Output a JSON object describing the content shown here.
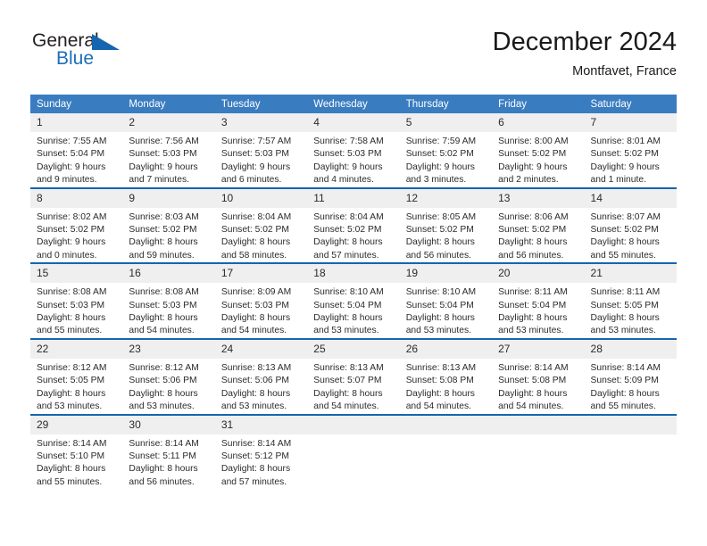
{
  "logo": {
    "word_top": "General",
    "word_bottom": "Blue",
    "triangle_color": "#1565b0",
    "blue_text_color": "#1c6fba"
  },
  "header": {
    "month_title": "December 2024",
    "location": "Montfavet, France"
  },
  "theme": {
    "header_blue": "#3a7cc0",
    "row_border_blue": "#1565b0",
    "daynum_bg": "#efefef"
  },
  "calendar": {
    "weekday_headers": [
      "Sunday",
      "Monday",
      "Tuesday",
      "Wednesday",
      "Thursday",
      "Friday",
      "Saturday"
    ],
    "weeks": [
      [
        {
          "day": "1",
          "sunrise": "Sunrise: 7:55 AM",
          "sunset": "Sunset: 5:04 PM",
          "daylight1": "Daylight: 9 hours",
          "daylight2": "and 9 minutes."
        },
        {
          "day": "2",
          "sunrise": "Sunrise: 7:56 AM",
          "sunset": "Sunset: 5:03 PM",
          "daylight1": "Daylight: 9 hours",
          "daylight2": "and 7 minutes."
        },
        {
          "day": "3",
          "sunrise": "Sunrise: 7:57 AM",
          "sunset": "Sunset: 5:03 PM",
          "daylight1": "Daylight: 9 hours",
          "daylight2": "and 6 minutes."
        },
        {
          "day": "4",
          "sunrise": "Sunrise: 7:58 AM",
          "sunset": "Sunset: 5:03 PM",
          "daylight1": "Daylight: 9 hours",
          "daylight2": "and 4 minutes."
        },
        {
          "day": "5",
          "sunrise": "Sunrise: 7:59 AM",
          "sunset": "Sunset: 5:02 PM",
          "daylight1": "Daylight: 9 hours",
          "daylight2": "and 3 minutes."
        },
        {
          "day": "6",
          "sunrise": "Sunrise: 8:00 AM",
          "sunset": "Sunset: 5:02 PM",
          "daylight1": "Daylight: 9 hours",
          "daylight2": "and 2 minutes."
        },
        {
          "day": "7",
          "sunrise": "Sunrise: 8:01 AM",
          "sunset": "Sunset: 5:02 PM",
          "daylight1": "Daylight: 9 hours",
          "daylight2": "and 1 minute."
        }
      ],
      [
        {
          "day": "8",
          "sunrise": "Sunrise: 8:02 AM",
          "sunset": "Sunset: 5:02 PM",
          "daylight1": "Daylight: 9 hours",
          "daylight2": "and 0 minutes."
        },
        {
          "day": "9",
          "sunrise": "Sunrise: 8:03 AM",
          "sunset": "Sunset: 5:02 PM",
          "daylight1": "Daylight: 8 hours",
          "daylight2": "and 59 minutes."
        },
        {
          "day": "10",
          "sunrise": "Sunrise: 8:04 AM",
          "sunset": "Sunset: 5:02 PM",
          "daylight1": "Daylight: 8 hours",
          "daylight2": "and 58 minutes."
        },
        {
          "day": "11",
          "sunrise": "Sunrise: 8:04 AM",
          "sunset": "Sunset: 5:02 PM",
          "daylight1": "Daylight: 8 hours",
          "daylight2": "and 57 minutes."
        },
        {
          "day": "12",
          "sunrise": "Sunrise: 8:05 AM",
          "sunset": "Sunset: 5:02 PM",
          "daylight1": "Daylight: 8 hours",
          "daylight2": "and 56 minutes."
        },
        {
          "day": "13",
          "sunrise": "Sunrise: 8:06 AM",
          "sunset": "Sunset: 5:02 PM",
          "daylight1": "Daylight: 8 hours",
          "daylight2": "and 56 minutes."
        },
        {
          "day": "14",
          "sunrise": "Sunrise: 8:07 AM",
          "sunset": "Sunset: 5:02 PM",
          "daylight1": "Daylight: 8 hours",
          "daylight2": "and 55 minutes."
        }
      ],
      [
        {
          "day": "15",
          "sunrise": "Sunrise: 8:08 AM",
          "sunset": "Sunset: 5:03 PM",
          "daylight1": "Daylight: 8 hours",
          "daylight2": "and 55 minutes."
        },
        {
          "day": "16",
          "sunrise": "Sunrise: 8:08 AM",
          "sunset": "Sunset: 5:03 PM",
          "daylight1": "Daylight: 8 hours",
          "daylight2": "and 54 minutes."
        },
        {
          "day": "17",
          "sunrise": "Sunrise: 8:09 AM",
          "sunset": "Sunset: 5:03 PM",
          "daylight1": "Daylight: 8 hours",
          "daylight2": "and 54 minutes."
        },
        {
          "day": "18",
          "sunrise": "Sunrise: 8:10 AM",
          "sunset": "Sunset: 5:04 PM",
          "daylight1": "Daylight: 8 hours",
          "daylight2": "and 53 minutes."
        },
        {
          "day": "19",
          "sunrise": "Sunrise: 8:10 AM",
          "sunset": "Sunset: 5:04 PM",
          "daylight1": "Daylight: 8 hours",
          "daylight2": "and 53 minutes."
        },
        {
          "day": "20",
          "sunrise": "Sunrise: 8:11 AM",
          "sunset": "Sunset: 5:04 PM",
          "daylight1": "Daylight: 8 hours",
          "daylight2": "and 53 minutes."
        },
        {
          "day": "21",
          "sunrise": "Sunrise: 8:11 AM",
          "sunset": "Sunset: 5:05 PM",
          "daylight1": "Daylight: 8 hours",
          "daylight2": "and 53 minutes."
        }
      ],
      [
        {
          "day": "22",
          "sunrise": "Sunrise: 8:12 AM",
          "sunset": "Sunset: 5:05 PM",
          "daylight1": "Daylight: 8 hours",
          "daylight2": "and 53 minutes."
        },
        {
          "day": "23",
          "sunrise": "Sunrise: 8:12 AM",
          "sunset": "Sunset: 5:06 PM",
          "daylight1": "Daylight: 8 hours",
          "daylight2": "and 53 minutes."
        },
        {
          "day": "24",
          "sunrise": "Sunrise: 8:13 AM",
          "sunset": "Sunset: 5:06 PM",
          "daylight1": "Daylight: 8 hours",
          "daylight2": "and 53 minutes."
        },
        {
          "day": "25",
          "sunrise": "Sunrise: 8:13 AM",
          "sunset": "Sunset: 5:07 PM",
          "daylight1": "Daylight: 8 hours",
          "daylight2": "and 54 minutes."
        },
        {
          "day": "26",
          "sunrise": "Sunrise: 8:13 AM",
          "sunset": "Sunset: 5:08 PM",
          "daylight1": "Daylight: 8 hours",
          "daylight2": "and 54 minutes."
        },
        {
          "day": "27",
          "sunrise": "Sunrise: 8:14 AM",
          "sunset": "Sunset: 5:08 PM",
          "daylight1": "Daylight: 8 hours",
          "daylight2": "and 54 minutes."
        },
        {
          "day": "28",
          "sunrise": "Sunrise: 8:14 AM",
          "sunset": "Sunset: 5:09 PM",
          "daylight1": "Daylight: 8 hours",
          "daylight2": "and 55 minutes."
        }
      ],
      [
        {
          "day": "29",
          "sunrise": "Sunrise: 8:14 AM",
          "sunset": "Sunset: 5:10 PM",
          "daylight1": "Daylight: 8 hours",
          "daylight2": "and 55 minutes."
        },
        {
          "day": "30",
          "sunrise": "Sunrise: 8:14 AM",
          "sunset": "Sunset: 5:11 PM",
          "daylight1": "Daylight: 8 hours",
          "daylight2": "and 56 minutes."
        },
        {
          "day": "31",
          "sunrise": "Sunrise: 8:14 AM",
          "sunset": "Sunset: 5:12 PM",
          "daylight1": "Daylight: 8 hours",
          "daylight2": "and 57 minutes."
        },
        {
          "day": "",
          "sunrise": "",
          "sunset": "",
          "daylight1": "",
          "daylight2": ""
        },
        {
          "day": "",
          "sunrise": "",
          "sunset": "",
          "daylight1": "",
          "daylight2": ""
        },
        {
          "day": "",
          "sunrise": "",
          "sunset": "",
          "daylight1": "",
          "daylight2": ""
        },
        {
          "day": "",
          "sunrise": "",
          "sunset": "",
          "daylight1": "",
          "daylight2": ""
        }
      ]
    ]
  }
}
